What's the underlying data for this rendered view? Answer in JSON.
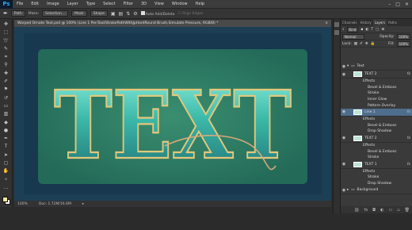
{
  "app": {
    "logo": "Ps"
  },
  "menu": [
    "File",
    "Edit",
    "Image",
    "Layer",
    "Type",
    "Select",
    "Filter",
    "3D",
    "View",
    "Window",
    "Help"
  ],
  "window_controls": [
    "–",
    "□",
    "✕"
  ],
  "options": {
    "path_mode": "Path",
    "make_label": "Make:",
    "selection_btn": "Selection...",
    "mask_btn": "Mask",
    "shape_btn": "Shape",
    "auto_add_delete": "Auto Add/Delete",
    "align_edges": "Align Edges"
  },
  "document": {
    "tab_title": "Warped Ornate Text.psd @ 100% (Line 1 PenTool/StrokePathWithJpHardRound Brush,Simulate Pressure, RGB/8) *",
    "art_text": "TEXT",
    "zoom": "100%",
    "doc_info": "Doc: 1.72M/16.6M"
  },
  "panel": {
    "tabs": [
      "Channels",
      "History",
      "Layers",
      "Paths"
    ],
    "active_tab": "Layers",
    "kind_label": "Kind",
    "blend_mode": "Normal",
    "opacity_label": "Opacity:",
    "opacity_value": "100%",
    "lock_label": "Lock:",
    "fill_label": "Fill:",
    "fill_value": "100%",
    "fx_symbol": "fx"
  },
  "layers": [
    {
      "type": "group",
      "name": "Text"
    },
    {
      "type": "layer",
      "name": "TEXT 2",
      "fx": true
    },
    {
      "type": "sub",
      "name": "Effects"
    },
    {
      "type": "effect",
      "name": "Bevel & Emboss"
    },
    {
      "type": "effect",
      "name": "Stroke"
    },
    {
      "type": "effect",
      "name": "Inner Glow"
    },
    {
      "type": "effect",
      "name": "Pattern Overlay"
    },
    {
      "type": "layer",
      "name": "Line 1",
      "fx": true,
      "selected": true
    },
    {
      "type": "sub",
      "name": "Effects"
    },
    {
      "type": "effect",
      "name": "Bevel & Emboss"
    },
    {
      "type": "effect",
      "name": "Drop Shadow"
    },
    {
      "type": "layer",
      "name": "TEXT 2",
      "fx": true
    },
    {
      "type": "sub",
      "name": "Effects"
    },
    {
      "type": "effect",
      "name": "Bevel & Emboss"
    },
    {
      "type": "effect",
      "name": "Stroke"
    },
    {
      "type": "layer",
      "name": "TEXT 1",
      "fx": true
    },
    {
      "type": "sub",
      "name": "Effects"
    },
    {
      "type": "effect",
      "name": "Stroke"
    },
    {
      "type": "effect",
      "name": "Drop Shadow"
    },
    {
      "type": "group",
      "name": "Background"
    }
  ],
  "colors": {
    "accent_selected": "#4f6d8c",
    "fg_swatch": "#f0e6a0",
    "bg_swatch": "#ffffff",
    "canvas_green": "#2d7b63",
    "frame_blue": "#1c3f56"
  }
}
